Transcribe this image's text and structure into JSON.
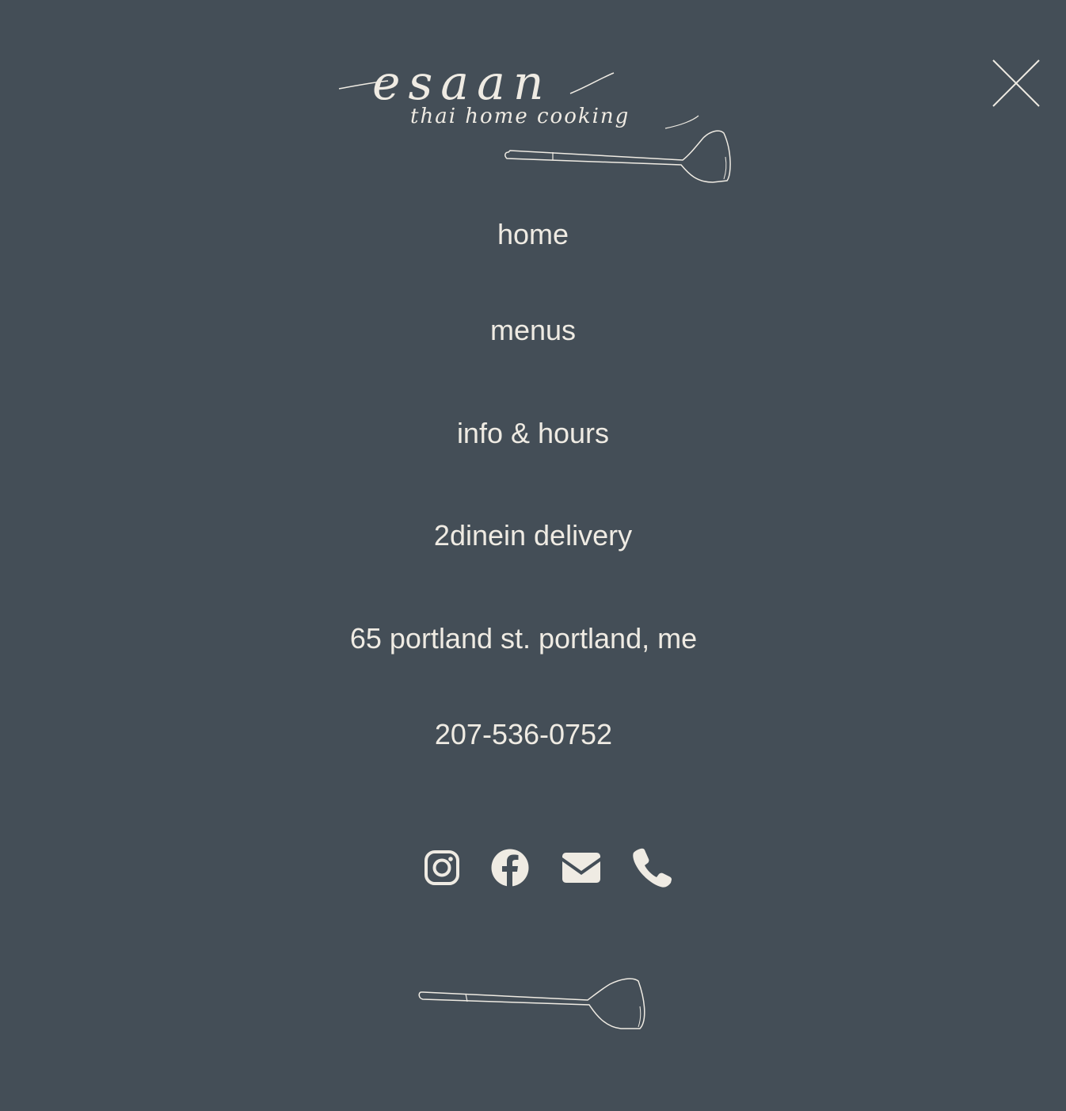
{
  "brand": {
    "name": "esaan",
    "tagline": "thai home cooking"
  },
  "nav": {
    "items": [
      {
        "label": "home"
      },
      {
        "label": "menus"
      },
      {
        "label": "info & hours"
      },
      {
        "label": "2dinein delivery"
      },
      {
        "label": "65 portland st. portland, me"
      },
      {
        "label": "207-536-0752"
      }
    ]
  },
  "socials": [
    {
      "icon": "instagram-icon"
    },
    {
      "icon": "facebook-icon"
    },
    {
      "icon": "email-icon"
    },
    {
      "icon": "phone-icon"
    }
  ],
  "icons": {
    "close": "close-icon",
    "spatula": "spatula-icon"
  },
  "colors": {
    "background": "#444e57",
    "foreground": "#efebe3"
  }
}
